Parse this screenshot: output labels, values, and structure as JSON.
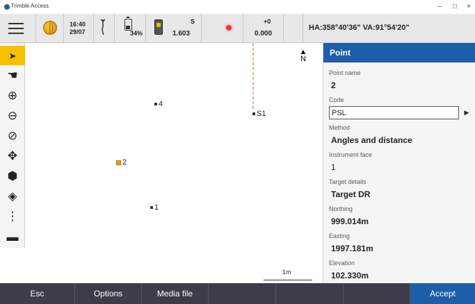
{
  "window": {
    "app_title": "Trimble Access",
    "minimize_glyph": "–",
    "maximize_glyph": "□",
    "close_glyph": "×"
  },
  "statusbar": {
    "time": "16:40",
    "date": "29/07",
    "battery_percent": "34%",
    "instrument_label": "S",
    "instrument_value": "1.603",
    "offset_label": "+0",
    "offset_value": "0.000",
    "angles": "HA:358°40'36\"  VA:91°54'20\""
  },
  "toolbar": {
    "tools": [
      {
        "name": "select-tool",
        "icon": "arrow-pointer-icon",
        "glyph": "➤",
        "active": true
      },
      {
        "name": "pan-tool",
        "icon": "hand-icon",
        "glyph": "☚",
        "active": false
      },
      {
        "name": "zoom-in-tool",
        "icon": "zoom-in-icon",
        "glyph": "⊕",
        "active": false
      },
      {
        "name": "zoom-out-tool",
        "icon": "zoom-out-icon",
        "glyph": "⊖",
        "active": false
      },
      {
        "name": "zoom-extents-tool",
        "icon": "zoom-extents-icon",
        "glyph": "⊘",
        "active": false
      },
      {
        "name": "orbit-tool",
        "icon": "orbit-icon",
        "glyph": "✥",
        "active": false
      },
      {
        "name": "view-3d-tool",
        "icon": "cube-icon",
        "glyph": "⬢",
        "active": false
      },
      {
        "name": "layers-tool",
        "icon": "layers-icon",
        "glyph": "◈",
        "active": false
      },
      {
        "name": "more-tool",
        "icon": "more-vertical-icon",
        "glyph": "⋮",
        "active": false
      },
      {
        "name": "video-tool",
        "icon": "video-camera-icon",
        "glyph": "▬",
        "active": false
      }
    ]
  },
  "map": {
    "points": [
      {
        "label": "4",
        "selected": false
      },
      {
        "label": "S1",
        "selected": false
      },
      {
        "label": "2",
        "selected": true
      },
      {
        "label": "1",
        "selected": false
      }
    ],
    "north_label": "N",
    "scale_label": "1m"
  },
  "panel": {
    "title": "Point",
    "point_name_label": "Point name",
    "point_name_value": "2",
    "code_label": "Code",
    "code_value": "PSL",
    "method_label": "Method",
    "method_value": "Angles and distance",
    "face_label": "Instrument face",
    "face_value": "1",
    "target_label": "Target details",
    "target_value": "Target DR",
    "northing_label": "Northing",
    "northing_value": "999.014m",
    "easting_label": "Easting",
    "easting_value": "1997.181m",
    "elevation_label": "Elevation",
    "elevation_value": "102.330m"
  },
  "softkeys": {
    "esc": "Esc",
    "options": "Options",
    "media": "Media file",
    "accept": "Accept"
  },
  "colors": {
    "accent": "#1e5da7",
    "active_tool": "#f5c000",
    "softkey_bg": "#3c3d48",
    "selected_point": "#f09a00",
    "laser": "#e83b3b"
  }
}
